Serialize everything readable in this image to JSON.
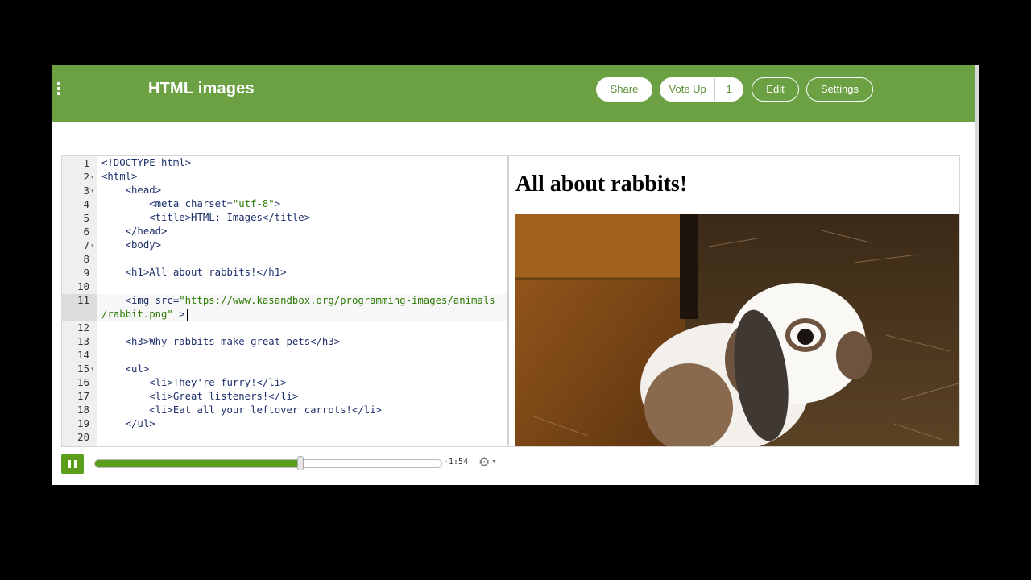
{
  "header": {
    "title": "HTML images",
    "share_label": "Share",
    "vote_label": "Vote Up",
    "vote_count": "1",
    "edit_label": "Edit",
    "settings_label": "Settings"
  },
  "editor": {
    "lines": [
      {
        "n": "1",
        "fold": ""
      },
      {
        "n": "2",
        "fold": "▾"
      },
      {
        "n": "3",
        "fold": "▾"
      },
      {
        "n": "4",
        "fold": ""
      },
      {
        "n": "5",
        "fold": ""
      },
      {
        "n": "6",
        "fold": ""
      },
      {
        "n": "7",
        "fold": "▾"
      },
      {
        "n": "8",
        "fold": ""
      },
      {
        "n": "9",
        "fold": ""
      },
      {
        "n": "10",
        "fold": ""
      },
      {
        "n": "11",
        "fold": ""
      },
      {
        "n": "12",
        "fold": ""
      },
      {
        "n": "13",
        "fold": ""
      },
      {
        "n": "14",
        "fold": ""
      },
      {
        "n": "15",
        "fold": "▾"
      },
      {
        "n": "16",
        "fold": ""
      },
      {
        "n": "17",
        "fold": ""
      },
      {
        "n": "18",
        "fold": ""
      },
      {
        "n": "19",
        "fold": ""
      },
      {
        "n": "20",
        "fold": ""
      }
    ],
    "code": {
      "l1": "<!DOCTYPE html>",
      "l2": "<html>",
      "l3": "    <head>",
      "l4a": "        <meta charset=",
      "l4b": "\"utf-8\"",
      "l4c": ">",
      "l5": "        <title>HTML: Images</title>",
      "l6": "    </head>",
      "l7": "    <body>",
      "l9": "    <h1>All about rabbits!</h1>",
      "l11a": "    <img src=",
      "l11b": "\"https://www.kasandbox.org/programming-images/animals",
      "l11c": "/rabbit.png\"",
      "l11d": " >",
      "l13": "    <h3>Why rabbits make great pets</h3>",
      "l15": "    <ul>",
      "l16": "        <li>They're furry!</li>",
      "l17": "        <li>Great listeners!</li>",
      "l18": "        <li>Eat all your leftover carrots!</li>",
      "l19": "    </ul>"
    }
  },
  "preview": {
    "heading": "All about rabbits!"
  },
  "player": {
    "progress": 0.59,
    "time_remaining": "-1:54"
  }
}
